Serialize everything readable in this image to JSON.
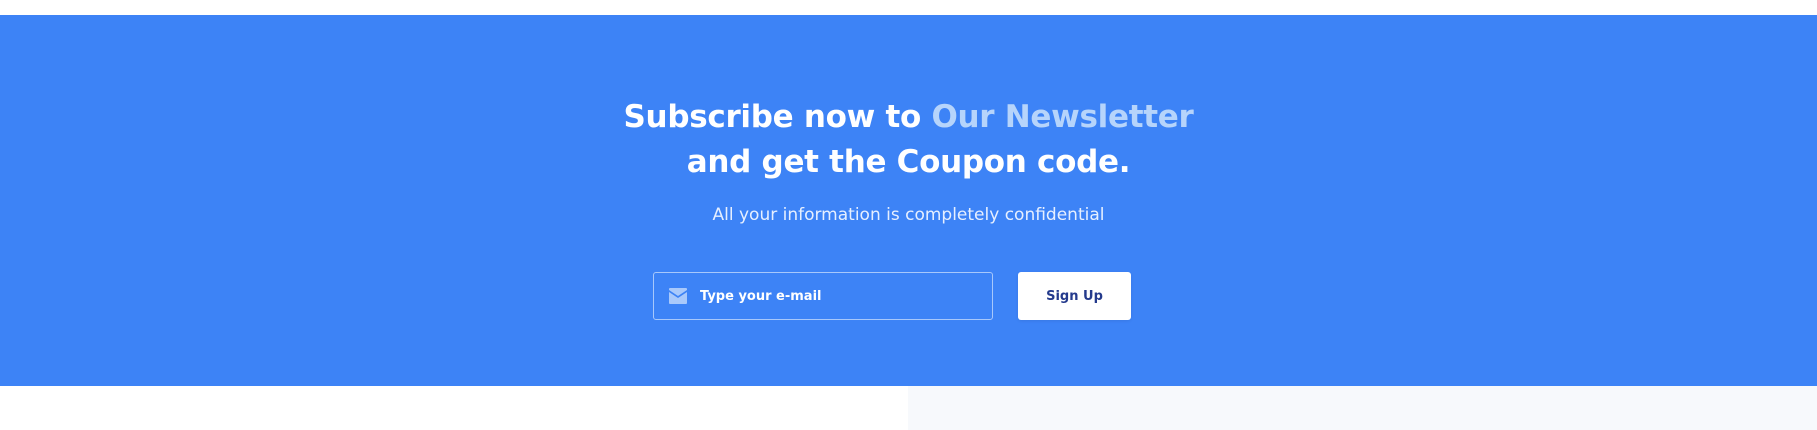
{
  "newsletter": {
    "heading_line1_prefix": "Subscribe now to ",
    "heading_line1_accent": "Our Newsletter",
    "heading_line2": "and get the Coupon code.",
    "subtext": "All your information is completely confidential",
    "email_placeholder": "Type your e-mail",
    "email_icon": "envelope-icon",
    "signup_label": "Sign Up"
  },
  "colors": {
    "section_background": "#3d83f6",
    "heading_accent": "#b6d4fb",
    "button_text": "#243a8c",
    "bottom_right_panel": "#f7f9fc"
  }
}
